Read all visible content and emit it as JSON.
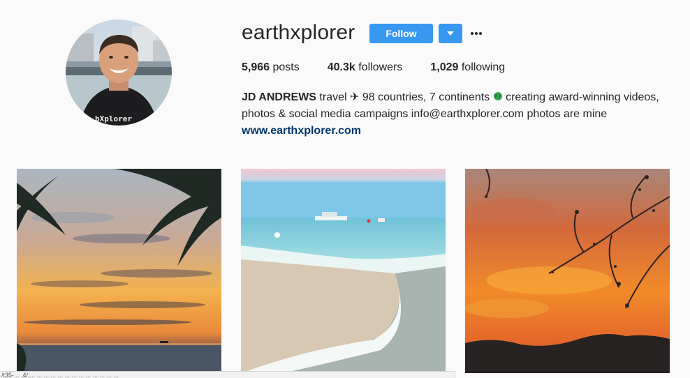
{
  "profile": {
    "username": "earthxplorer",
    "avatar_icon": "profile-photo",
    "follow_label": "Follow",
    "dropdown_icon": "chevron-down-icon",
    "more_icon": "more-options-icon",
    "stats": {
      "posts_count": "5,966",
      "posts_label": " posts",
      "followers_count": "40.3k",
      "followers_label": " followers",
      "following_count": "1,029",
      "following_label": " following"
    },
    "bio": {
      "name": "JD ANDREWS",
      "line1": " travel ✈ 98 countries, 7 continents ",
      "globe_icon": "globe-icon",
      "line1_end": " creating award-winning videos,",
      "line2": "photos & social media campaigns info@earthxplorer.com photos are mine",
      "website": "www.earthxplorer.com"
    }
  },
  "posts": [
    {
      "icon": "sunset-palm-photo"
    },
    {
      "icon": "beach-boat-photo"
    },
    {
      "icon": "orange-sky-tree-photo"
    }
  ],
  "statusbar": {
    "text": "/t35-... ,4/,... ... ... ... ... ... ... ... ... ... ... ... ..."
  },
  "colors": {
    "accent": "#3897f0",
    "link": "#003569",
    "text": "#262626",
    "background": "#fafafa"
  }
}
